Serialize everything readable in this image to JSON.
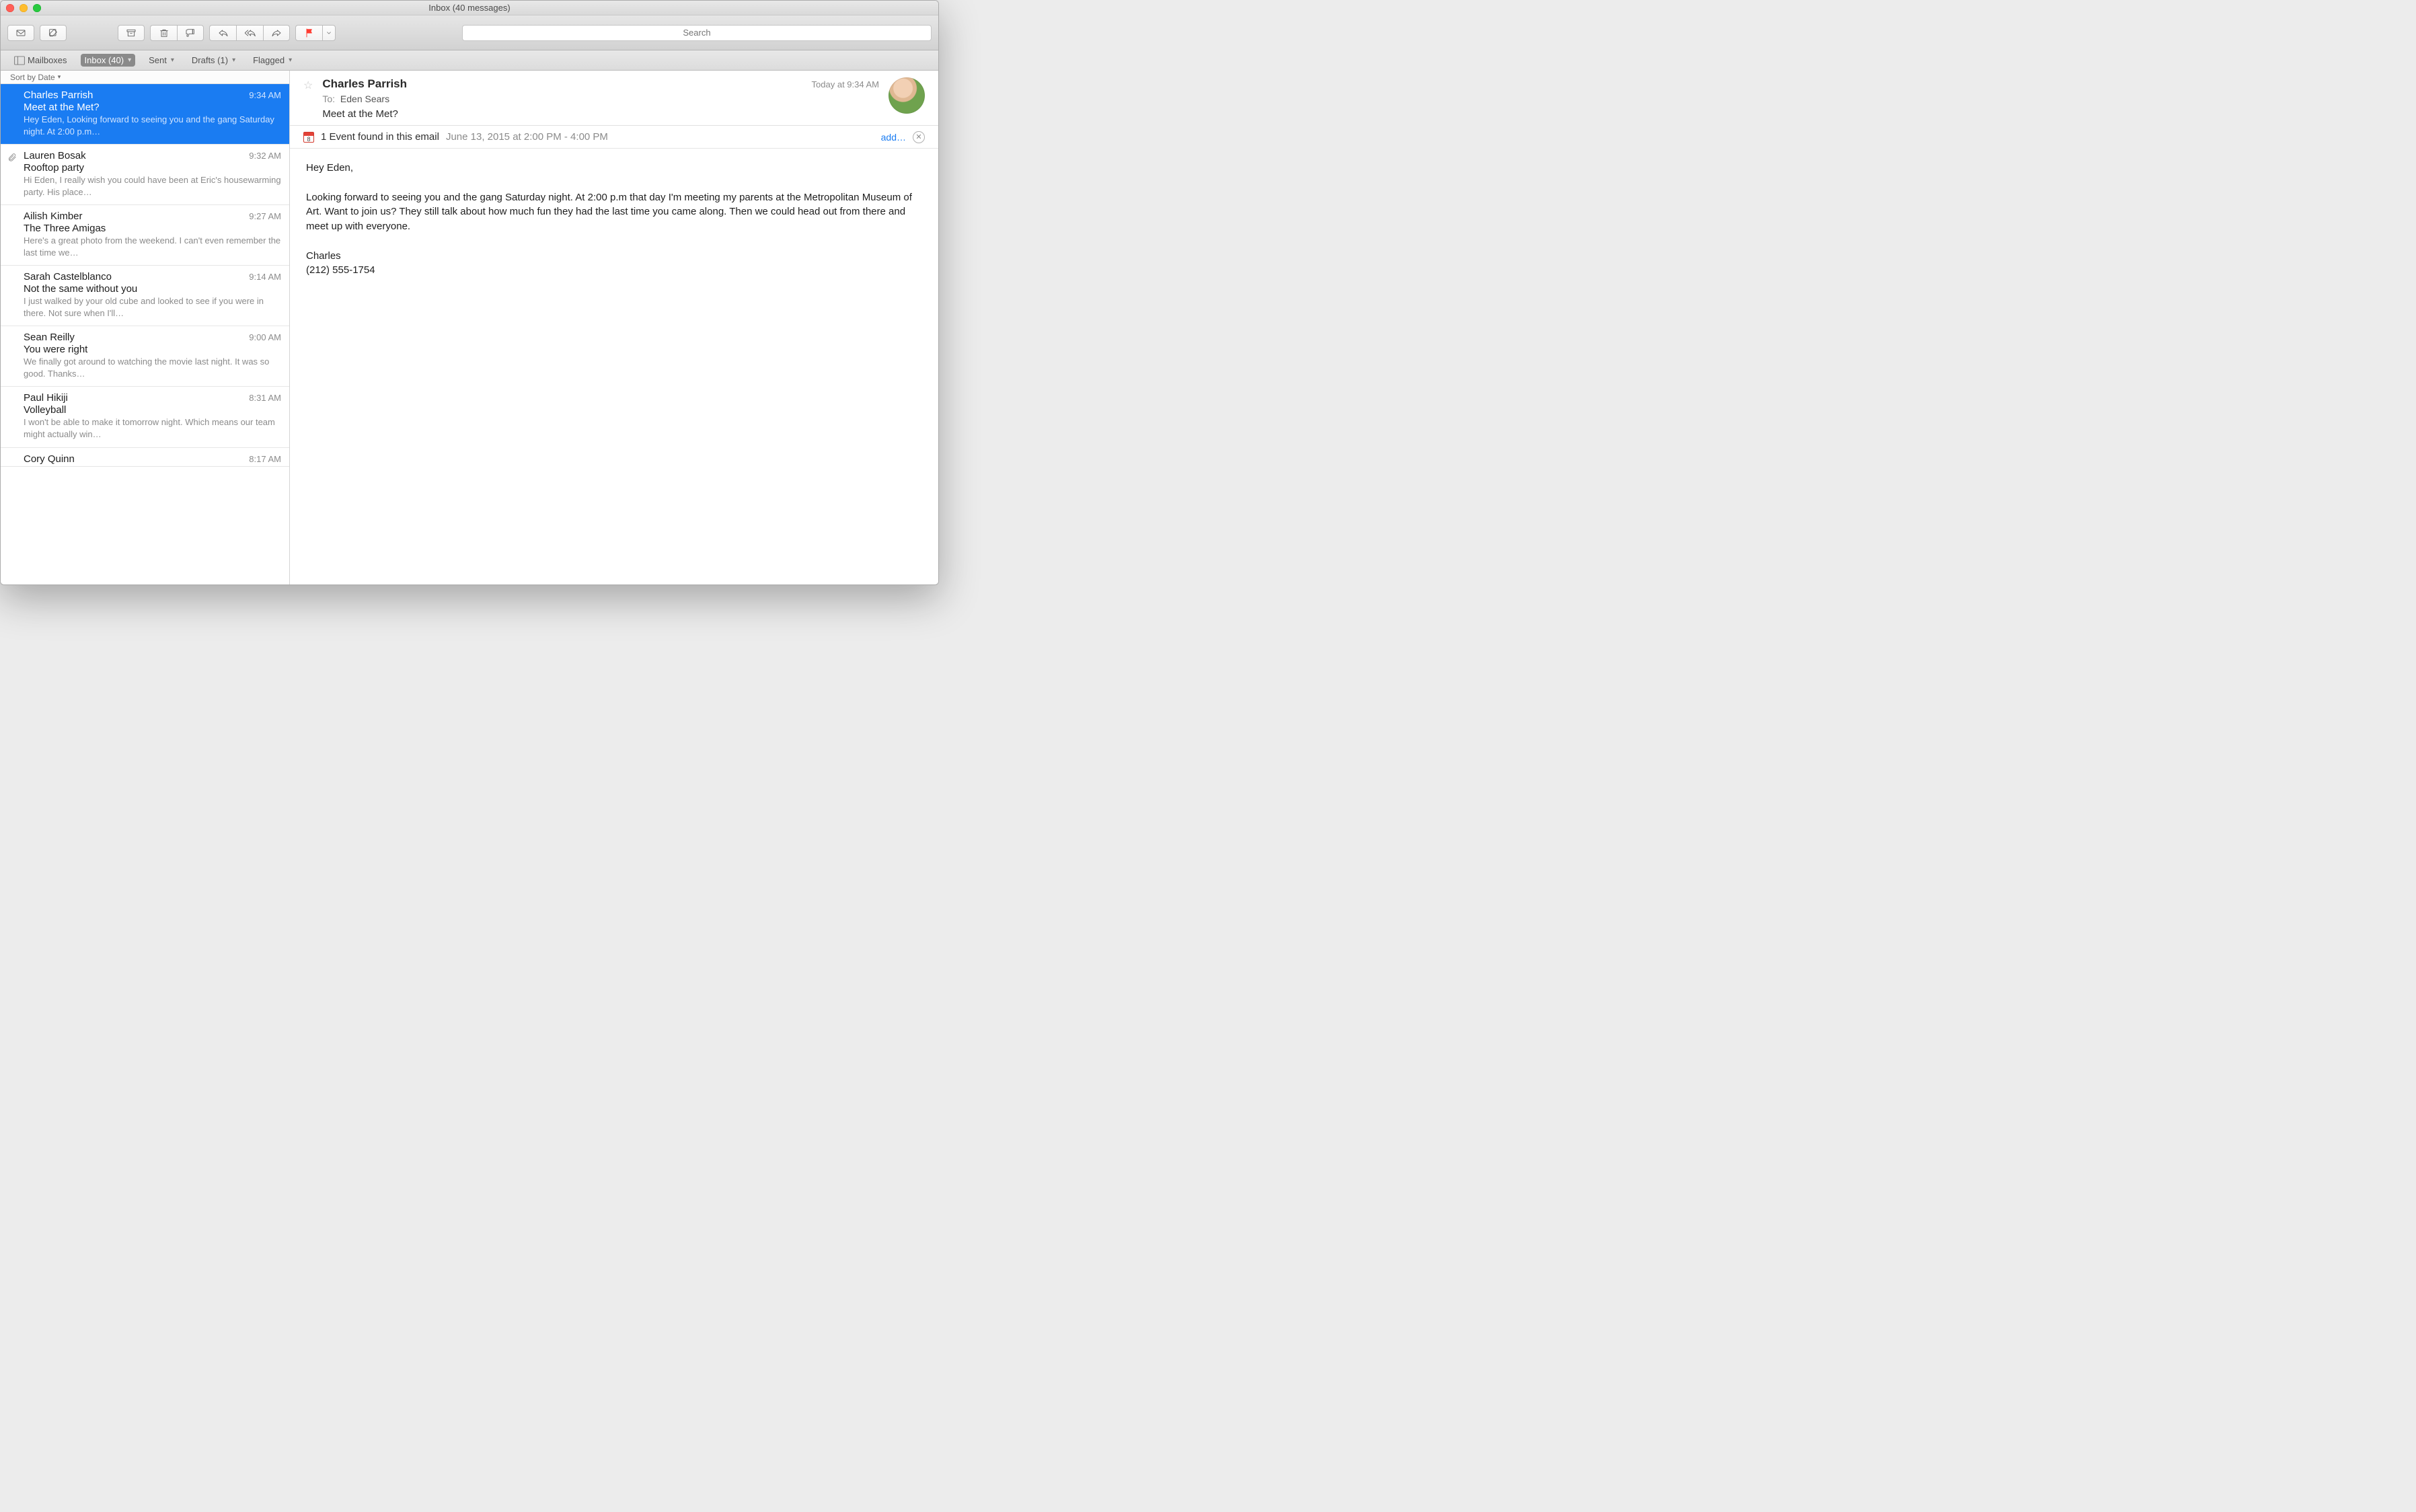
{
  "window": {
    "title": "Inbox (40 messages)"
  },
  "search": {
    "placeholder": "Search"
  },
  "favorites": {
    "mailboxes": "Mailboxes",
    "inbox": "Inbox (40)",
    "sent": "Sent",
    "drafts": "Drafts (1)",
    "flagged": "Flagged"
  },
  "sort": {
    "label": "Sort by Date"
  },
  "messages": [
    {
      "sender": "Charles Parrish",
      "time": "9:34 AM",
      "subject": "Meet at the Met?",
      "preview": "Hey Eden, Looking forward to seeing you and the gang Saturday night. At 2:00 p.m…",
      "selected": true,
      "attachment": false
    },
    {
      "sender": "Lauren Bosak",
      "time": "9:32 AM",
      "subject": "Rooftop party",
      "preview": "Hi Eden, I really wish you could have been at Eric's housewarming party. His place…",
      "selected": false,
      "attachment": true
    },
    {
      "sender": "Ailish Kimber",
      "time": "9:27 AM",
      "subject": "The Three Amigas",
      "preview": "Here's a great photo from the weekend. I can't even remember the last time we…",
      "selected": false,
      "attachment": false
    },
    {
      "sender": "Sarah Castelblanco",
      "time": "9:14 AM",
      "subject": "Not the same without you",
      "preview": "I just walked by your old cube and looked to see if you were in there. Not sure when I'll…",
      "selected": false,
      "attachment": false
    },
    {
      "sender": "Sean Reilly",
      "time": "9:00 AM",
      "subject": "You were right",
      "preview": "We finally got around to watching the movie last night. It was so good. Thanks…",
      "selected": false,
      "attachment": false
    },
    {
      "sender": "Paul Hikiji",
      "time": "8:31 AM",
      "subject": "Volleyball",
      "preview": "I won't be able to make it tomorrow night. Which means our team might actually win…",
      "selected": false,
      "attachment": false
    },
    {
      "sender": "Cory Quinn",
      "time": "8:17 AM",
      "subject": "",
      "preview": "",
      "selected": false,
      "attachment": false,
      "partial": true
    }
  ],
  "reading": {
    "from": "Charles Parrish",
    "when": "Today at 9:34 AM",
    "to_label": "To:",
    "to_value": "Eden Sears",
    "subject": "Meet at the Met?",
    "event_text": "1 Event found in this email",
    "event_date": "June 13, 2015 at 2:00 PM - 4:00 PM",
    "event_add": "add…",
    "body": "Hey Eden,\n\nLooking forward to seeing you and the gang Saturday night. At 2:00 p.m that day I'm meeting my parents at the Metropolitan Museum of Art. Want to join us? They still talk about how much fun they had the last time you came along. Then we could head out from there and meet up with everyone.\n\nCharles\n(212) 555-1754"
  }
}
